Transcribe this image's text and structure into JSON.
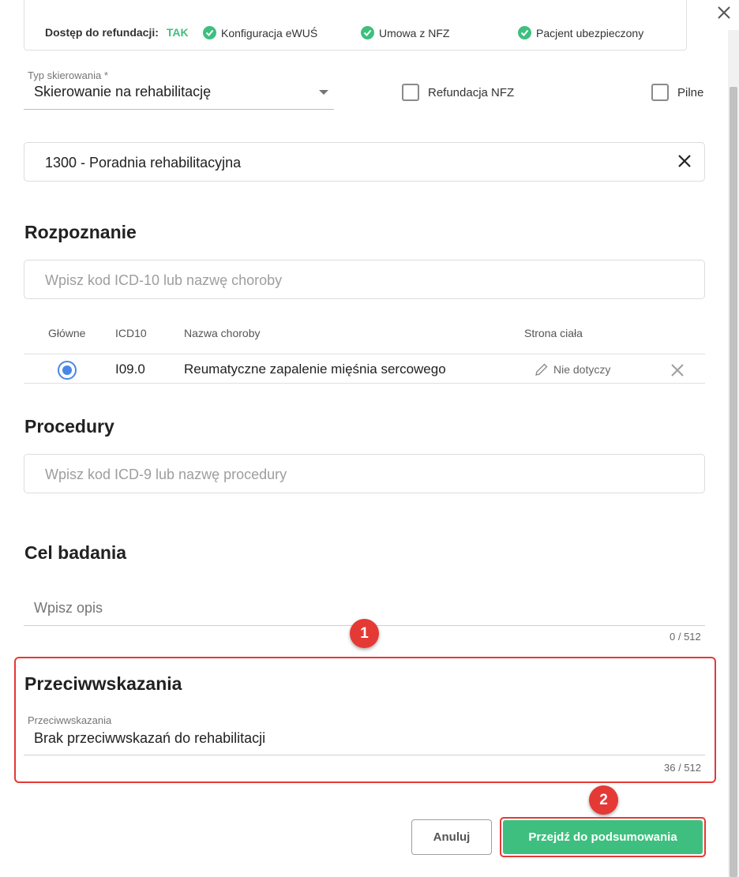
{
  "header": {
    "refund_access_label": "Dostęp do refundacji:",
    "refund_access_value": "TAK",
    "checks": [
      {
        "label": "Konfiguracja eWUŚ"
      },
      {
        "label": "Umowa z NFZ"
      },
      {
        "label": "Pacjent ubezpieczony"
      }
    ]
  },
  "referral": {
    "type_label": "Typ skierowania *",
    "type_value": "Skierowanie na rehabilitację",
    "refund_nfz_label": "Refundacja NFZ",
    "urgent_label": "Pilne",
    "clinic_value": "1300 - Poradnia rehabilitacyjna"
  },
  "diagnosis": {
    "title": "Rozpoznanie",
    "search_placeholder": "Wpisz kod ICD-10 lub nazwę choroby",
    "columns": {
      "main": "Główne",
      "icd10": "ICD10",
      "name": "Nazwa choroby",
      "body_side": "Strona ciała"
    },
    "rows": [
      {
        "icd10": "I09.0",
        "name": "Reumatyczne zapalenie mięśnia sercowego",
        "body_side": "Nie dotyczy"
      }
    ]
  },
  "procedures": {
    "title": "Procedury",
    "search_placeholder": "Wpisz kod ICD-9 lub nazwę procedury"
  },
  "purpose": {
    "title": "Cel badania",
    "placeholder": "Wpisz opis",
    "counter": "0 / 512"
  },
  "contraindications": {
    "title": "Przeciwwskazania",
    "field_label": "Przeciwwskazania",
    "value": "Brak przeciwwskazań do rehabilitacji",
    "counter": "36 / 512"
  },
  "annotations": {
    "badge1": "1",
    "badge2": "2"
  },
  "footer": {
    "cancel_label": "Anuluj",
    "next_label": "Przejdź do podsumowania"
  },
  "colors": {
    "accent_green": "#3fbf7f",
    "highlight_red": "#e53935",
    "radio_blue": "#4a86e8"
  }
}
